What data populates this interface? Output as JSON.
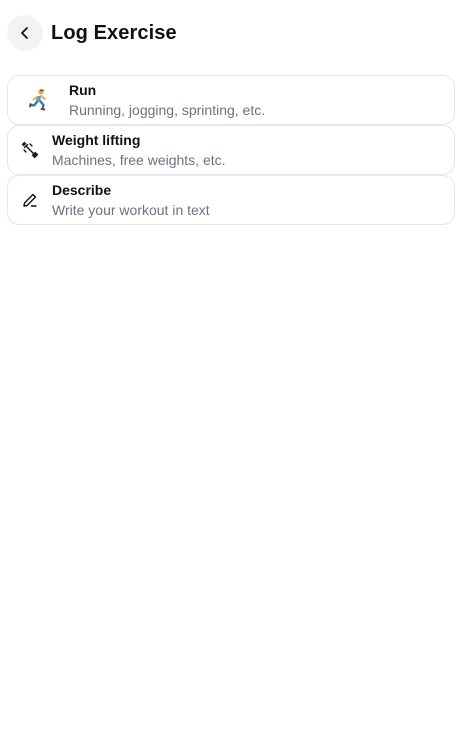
{
  "header": {
    "title": "Log Exercise",
    "back_icon": "chevron-left-icon"
  },
  "colors": {
    "back_button_bg": "#f2f3f5",
    "card_border": "#e6e7ea",
    "label_text": "#111111",
    "description_text": "#6b7280"
  },
  "exercises": [
    {
      "icon": "running-person-icon",
      "label": "Run",
      "description": "Running, jogging, sprinting, etc."
    },
    {
      "icon": "dumbbell-icon",
      "label": "Weight lifting",
      "description": "Machines, free weights, etc."
    },
    {
      "icon": "pencil-icon",
      "label": "Describe",
      "description": "Write your workout in text"
    }
  ]
}
